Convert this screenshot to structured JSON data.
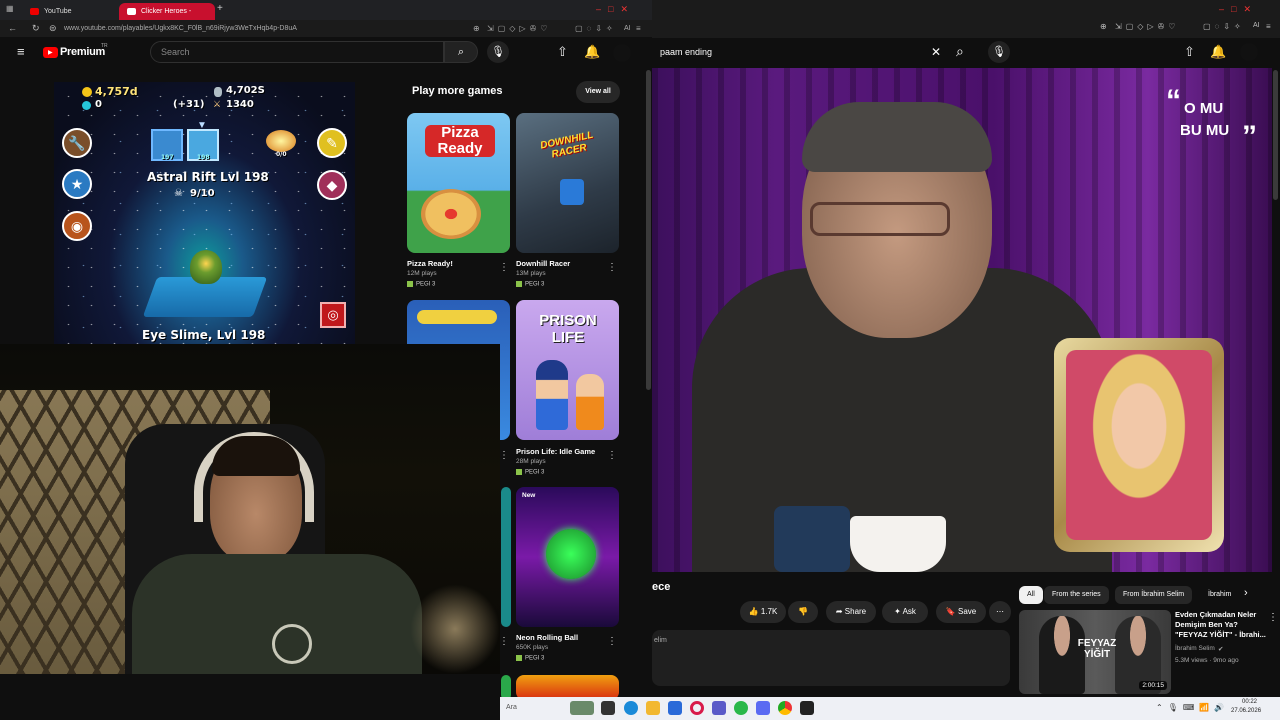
{
  "left_browser": {
    "tabs": [
      {
        "label": "YouTube",
        "active": false
      },
      {
        "label": "Clicker Heroes - YouTube",
        "active": true
      }
    ],
    "url": "www.youtube.com/playables/Ugkx8KC_F0lB_n69iRjyw3WeTxHqb4p-D8uA",
    "toolbar": {
      "ai_label": "AI"
    },
    "header": {
      "logo_text": "Premium",
      "logo_badge": "TR",
      "search_placeholder": "Search"
    },
    "game": {
      "gold": "4,757d",
      "gems": "0",
      "souls": "4,702S",
      "damage": "1340",
      "plus": "(+31)",
      "zone_title": "Astral Rift Lvl 198",
      "kills": "9/10",
      "monster_label": "Eye Slime, Lvl 198",
      "level_left": "197",
      "level_right": "198",
      "relic_count": "0/0"
    },
    "shelf": {
      "title": "Play more games",
      "view_all": "View all",
      "games": [
        {
          "title": "Pizza Ready!",
          "plays": "12M plays",
          "rating": "PEGI 3",
          "art": "Pizza\nReady"
        },
        {
          "title": "Downhill Racer",
          "plays": "13M plays",
          "rating": "PEGI 3",
          "art": "DOWNHILL\nRACER"
        },
        {
          "title": "Prison Life: Idle Game",
          "plays": "28M plays",
          "rating": "PEGI 3",
          "art": "PRISON\nLIFE"
        },
        {
          "title": "Neon Rolling Ball",
          "plays": "650K plays",
          "rating": "PEGI 3",
          "badge": "New"
        }
      ]
    }
  },
  "right_browser": {
    "search_value": "paam ending",
    "video": {
      "quote_line1": "O MU",
      "quote_line2": "BU MU"
    },
    "title_fragment": "ece",
    "description_fragment": "elim",
    "actions": {
      "likes": "1.7K",
      "share": "Share",
      "ask": "Ask",
      "save": "Save"
    },
    "chips": [
      "All",
      "From the series",
      "From İbrahim Selim",
      "İbrahim"
    ],
    "recommended": {
      "title": "Evden Çıkmadan Neler Demişim Ben Ya? \"FEYYAZ YİĞİT\" - İbrahi...",
      "channel": "İbrahim Selim",
      "meta": "5.3M views · 9mo ago",
      "duration": "2:00:15",
      "thumb_text": "FEYYAZ YİĞİT"
    }
  },
  "taskbar": {
    "search_placeholder": "Ara",
    "time": "00:22",
    "date": "27.06.2026"
  },
  "colors": {
    "yt_red": "#ff0000",
    "tab_active": "#c8102e",
    "bg": "#0f0f0f",
    "chip_bg": "#272727"
  }
}
